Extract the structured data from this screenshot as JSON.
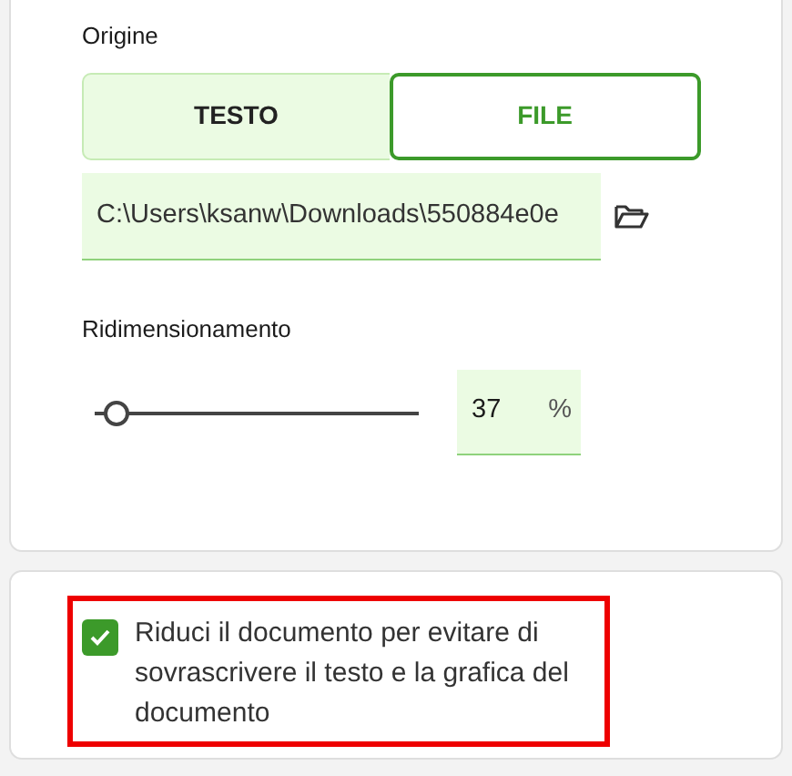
{
  "source": {
    "label": "Origine",
    "options": [
      {
        "label": "TESTO",
        "selected": false
      },
      {
        "label": "FILE",
        "selected": true
      }
    ],
    "path_field": {
      "value": "C:\\Users\\ksanw\\Downloads\\550884e0e"
    }
  },
  "resize": {
    "label": "Ridimensionamento",
    "level": 0.07,
    "value": "37",
    "unit": "%"
  },
  "shrink_option": {
    "label": "Riduci il documento per evitare di sovrascrivere il testo e la grafica del documento",
    "checked": true,
    "highlighted": true
  }
}
